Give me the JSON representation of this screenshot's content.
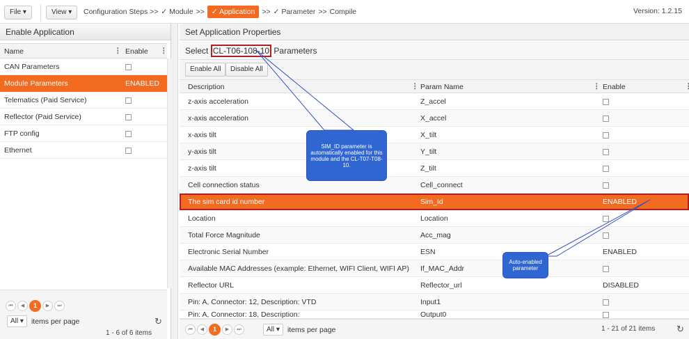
{
  "toolbar": {
    "file_label": "File ▾",
    "view_label": "View ▾",
    "steps_prefix": "Configuration Steps >>",
    "step_module": "✓ Module",
    "step_sep1": ">>",
    "step_application": "✓ Application",
    "step_sep2": ">>",
    "step_parameter": "✓ Parameter",
    "step_sep3": ">>",
    "step_compile": "Compile",
    "version": "Version: 1.2.15"
  },
  "left_panel": {
    "title": "Enable Application",
    "col_name": "Name",
    "col_enable": "Enable",
    "rows": [
      {
        "name": "CAN Parameters",
        "enable": ""
      },
      {
        "name": "Module Parameters",
        "enable": "ENABLED"
      },
      {
        "name": "Telematics (Paid Service)",
        "enable": ""
      },
      {
        "name": "Reflector (Paid Service)",
        "enable": ""
      },
      {
        "name": "FTP config",
        "enable": ""
      },
      {
        "name": "Ethernet",
        "enable": ""
      }
    ],
    "pager": {
      "first": "⏮",
      "prev": "◀",
      "current": "1",
      "next": "▶",
      "last": "⏭"
    },
    "ipp_value": "All",
    "ipp_label": "items per page",
    "count": "1 - 6 of 6 items",
    "refresh_icon": "↻"
  },
  "right_panel": {
    "title": "Set Application Properties",
    "select_prefix": "Select",
    "select_module": "CL-T06-108-10",
    "select_suffix": "Parameters",
    "enable_all": "Enable All",
    "disable_all": "Disable All",
    "col_description": "Description",
    "col_param": "Param Name",
    "col_enable": "Enable",
    "rows": [
      {
        "description": "z-axis acceleration",
        "param": "Z_accel",
        "enable": ""
      },
      {
        "description": "x-axis acceleration",
        "param": "X_accel",
        "enable": ""
      },
      {
        "description": "x-axis tilt",
        "param": "X_tilt",
        "enable": ""
      },
      {
        "description": "y-axis tilt",
        "param": "Y_tilt",
        "enable": ""
      },
      {
        "description": "z-axis tilt",
        "param": "Z_tilt",
        "enable": ""
      },
      {
        "description": "Cell connection status",
        "param": "Cell_connect",
        "enable": ""
      },
      {
        "description": "The sim card id number",
        "param": "Sim_Id",
        "enable": "ENABLED"
      },
      {
        "description": "Location",
        "param": "Location",
        "enable": ""
      },
      {
        "description": "Total Force Magnitude",
        "param": "Acc_mag",
        "enable": ""
      },
      {
        "description": "Electronic Serial Number",
        "param": "ESN",
        "enable": "ENABLED"
      },
      {
        "description": "Available MAC Addresses (example: Ethernet, WIFI Client, WIFI AP)",
        "param": "If_MAC_Addr",
        "enable": ""
      },
      {
        "description": "Reflector URL",
        "param": "Reflector_url",
        "enable": "DISABLED"
      },
      {
        "description": "Pin: A, Connector: 12, Description: VTD",
        "param": "Input1",
        "enable": ""
      },
      {
        "description": "Pin: A, Connector: 18, Description:",
        "param": "Output0",
        "enable": ""
      }
    ],
    "ipp_value": "All",
    "ipp_label": "items per page",
    "count": "1 - 21 of 21 items",
    "refresh_icon": "↻"
  },
  "callouts": {
    "sim_id_note": "SIM_ID parameter is automatically enabled for this module and the CL-T07-T08-10.",
    "auto_enabled_note": "Auto-enabled parameter"
  },
  "colors": {
    "accent": "#f26b21",
    "highlight_outline": "#b11e23",
    "callout": "#2f66d1"
  }
}
